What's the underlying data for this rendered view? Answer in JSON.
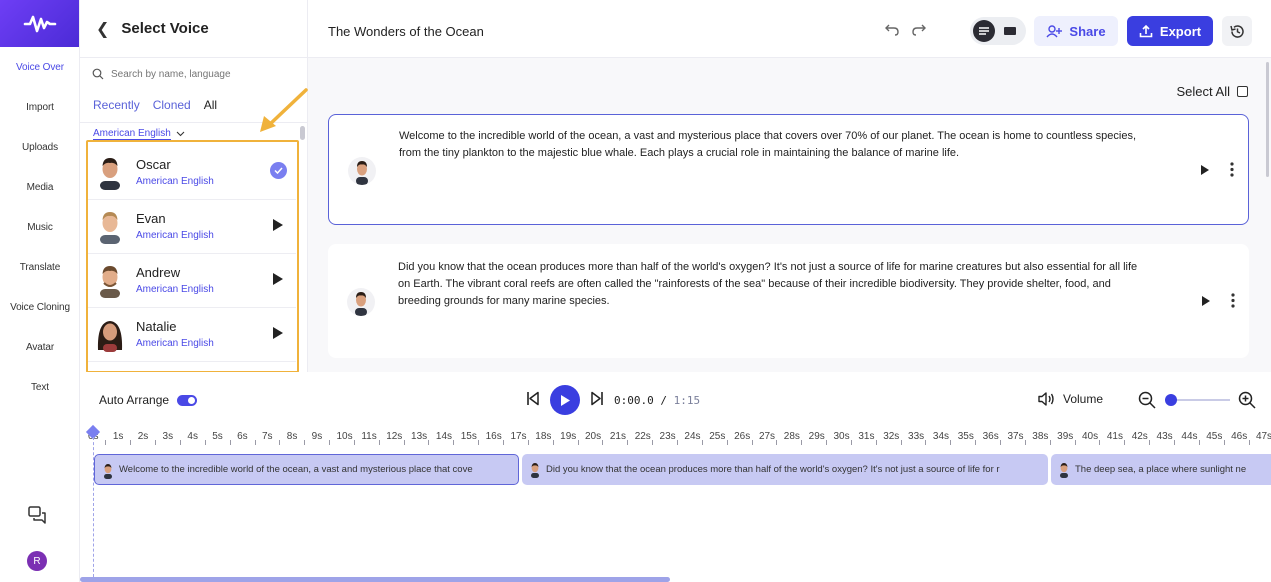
{
  "rail": {
    "items": [
      "Voice Over",
      "Import",
      "Uploads",
      "Media",
      "Music",
      "Translate",
      "Voice Cloning",
      "Avatar",
      "Text"
    ],
    "avatar_initial": "R"
  },
  "voice_panel": {
    "title": "Select Voice",
    "search_placeholder": "Search by name, language",
    "tabs": [
      "Recently",
      "Cloned",
      "All"
    ],
    "active_tab": "All",
    "language_filter": "American English",
    "voices": [
      {
        "name": "Oscar",
        "language": "American English",
        "selected": true
      },
      {
        "name": "Evan",
        "language": "American English",
        "selected": false
      },
      {
        "name": "Andrew",
        "language": "American English",
        "selected": false
      },
      {
        "name": "Natalie",
        "language": "American English",
        "selected": false
      }
    ]
  },
  "topbar": {
    "doc_title": "The Wonders of the Ocean",
    "share_label": "Share",
    "export_label": "Export"
  },
  "editor": {
    "select_all_label": "Select All",
    "paragraphs": [
      {
        "lines": [
          "Welcome to the incredible world of the ocean, a vast and mysterious place that covers over 70% of our planet. The ocean is home to countless species,",
          "from the tiny plankton to the majestic blue whale. Each plays a crucial role in maintaining the balance of marine life."
        ]
      },
      {
        "lines": [
          "Did you know that the ocean produces more than half of the world's oxygen? It's not just a source of life for marine creatures but also essential for all life",
          "on Earth. The vibrant coral reefs are often called the \"rainforests of the sea\" because of their incredible biodiversity. They provide shelter, food, and",
          "breeding grounds for many marine species."
        ]
      }
    ]
  },
  "transport": {
    "auto_arrange_label": "Auto Arrange",
    "current_time": "0:00.0",
    "separator": "/",
    "total_time": "1:15",
    "volume_label": "Volume"
  },
  "timeline": {
    "ticks": [
      "0s",
      "1s",
      "2s",
      "3s",
      "4s",
      "5s",
      "6s",
      "7s",
      "8s",
      "9s",
      "10s",
      "11s",
      "12s",
      "13s",
      "14s",
      "15s",
      "16s",
      "17s",
      "18s",
      "19s",
      "20s",
      "21s",
      "22s",
      "23s",
      "24s",
      "25s",
      "26s",
      "27s",
      "28s",
      "29s",
      "30s",
      "31s",
      "32s",
      "33s",
      "34s",
      "35s",
      "36s",
      "37s",
      "38s",
      "39s",
      "40s",
      "41s",
      "42s",
      "43s",
      "44s",
      "45s",
      "46s",
      "47s"
    ],
    "clips": [
      "Welcome to the incredible world of the ocean, a vast and mysterious place that cove",
      "Did you know that the ocean produces more than half of the world's oxygen? It's not just a source of life for r",
      "The deep sea, a place where sunlight ne"
    ]
  }
}
